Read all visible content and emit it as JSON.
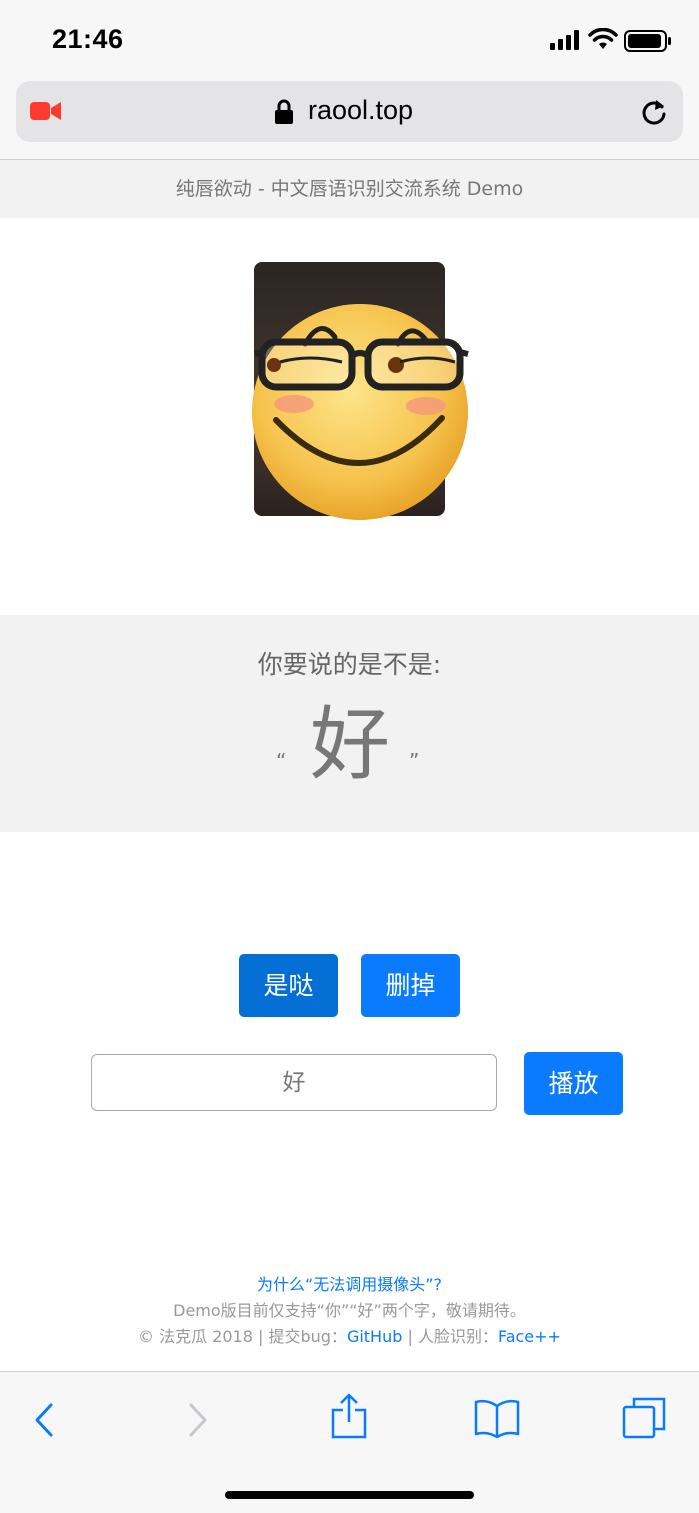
{
  "status": {
    "time": "21:46",
    "signal_icon": "signal-bars-icon",
    "wifi_icon": "wifi-icon",
    "battery_icon": "battery-icon"
  },
  "browser": {
    "url": "raool.top",
    "camera_indicator_icon": "video-camera-icon",
    "lock_icon": "lock-icon",
    "reload_icon": "reload-icon",
    "accent": "#ff3b30"
  },
  "page": {
    "header_title": "纯唇欲动 - 中文唇语识别交流系统 Demo",
    "prediction_label": "你要说的是不是:",
    "open_quote": "“",
    "close_quote": "”",
    "predicted_char": "好",
    "buttons": {
      "confirm": "是哒",
      "delete": "删掉",
      "play": "播放"
    },
    "input_value": "好",
    "brand_color": "#0a7bff"
  },
  "footer": {
    "camera_help_link": "为什么“无法调用摄像头”?",
    "notice": "Demo版目前仅支持“你”“好”两个字，敬请期待。",
    "copyright": "© 法克瓜 2018 | 提交bug：",
    "github_link": "GitHub",
    "separator": " | 人脸识别：",
    "facepp_link": "Face++"
  },
  "toolbar": {
    "back_icon": "back-chevron-icon",
    "forward_icon": "forward-chevron-icon",
    "share_icon": "share-icon",
    "bookmarks_icon": "bookmarks-book-icon",
    "tabs_icon": "tabs-icon"
  }
}
